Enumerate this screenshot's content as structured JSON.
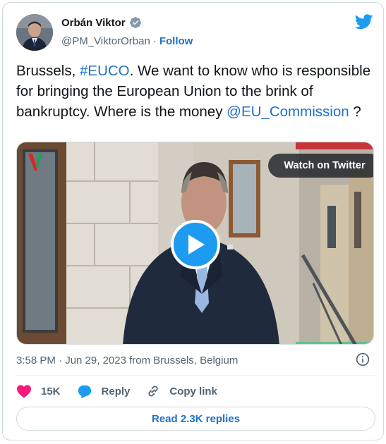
{
  "author": {
    "name": "Orbán Viktor",
    "handle": "@PM_ViktorOrban",
    "separator": "·",
    "follow_label": "Follow"
  },
  "tweet": {
    "text_prefix": "Brussels, ",
    "hashtag": "#EUCO",
    "text_body": ". We want to know who is responsible for bringing the European Union to the brink of bankruptcy. Where is the money ",
    "mention": "@EU_Commission",
    "text_suffix": " ?"
  },
  "video": {
    "watch_label": "Watch on Twitter"
  },
  "meta": {
    "timestamp": "3:58 PM · Jun 29, 2023 from Brussels, Belgium"
  },
  "actions": {
    "like_count": "15K",
    "reply_label": "Reply",
    "copy_label": "Copy link"
  },
  "replies_button": "Read 2.3K replies",
  "colors": {
    "link": "#1d72c9",
    "twitter_blue": "#1d9bf0",
    "like_red": "#f91880",
    "muted": "#536471"
  },
  "icons": [
    "verified-badge-icon",
    "twitter-bird-icon",
    "play-icon",
    "info-icon",
    "heart-icon",
    "reply-bubble-icon",
    "link-icon"
  ]
}
